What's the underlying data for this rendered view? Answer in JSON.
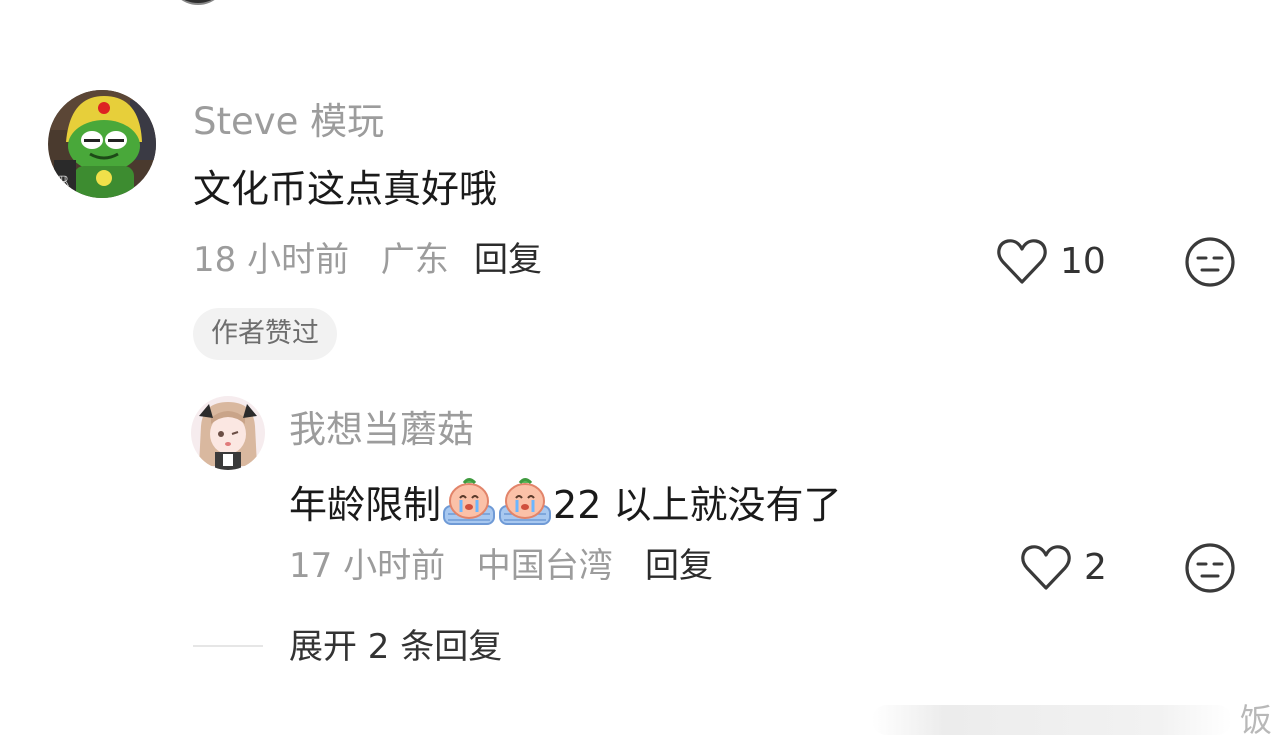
{
  "comments": [
    {
      "username": "Steve 模玩",
      "text": "文化币这点真好哦",
      "time": "18 小时前",
      "location": "广东",
      "reply_label": "回复",
      "likes": "10",
      "badge": "作者赞过"
    }
  ],
  "reply": {
    "username": "我想当蘑菇",
    "text_before": "年龄限制",
    "text_after": "22 以上就没有了",
    "emoji_names": [
      "crying-peach-emoji",
      "crying-peach-emoji"
    ],
    "time": "17 小时前",
    "location": "中国台湾",
    "reply_label": "回复",
    "likes": "2"
  },
  "expand_replies": "展开 2 条回复",
  "watermark": "饭",
  "colors": {
    "meta_gray": "#9c9c9c",
    "text_dark": "#1a1a1a",
    "badge_bg": "#f2f2f2"
  },
  "icons": {
    "like": "heart-outline-icon",
    "dislike": "neutral-face-icon"
  }
}
